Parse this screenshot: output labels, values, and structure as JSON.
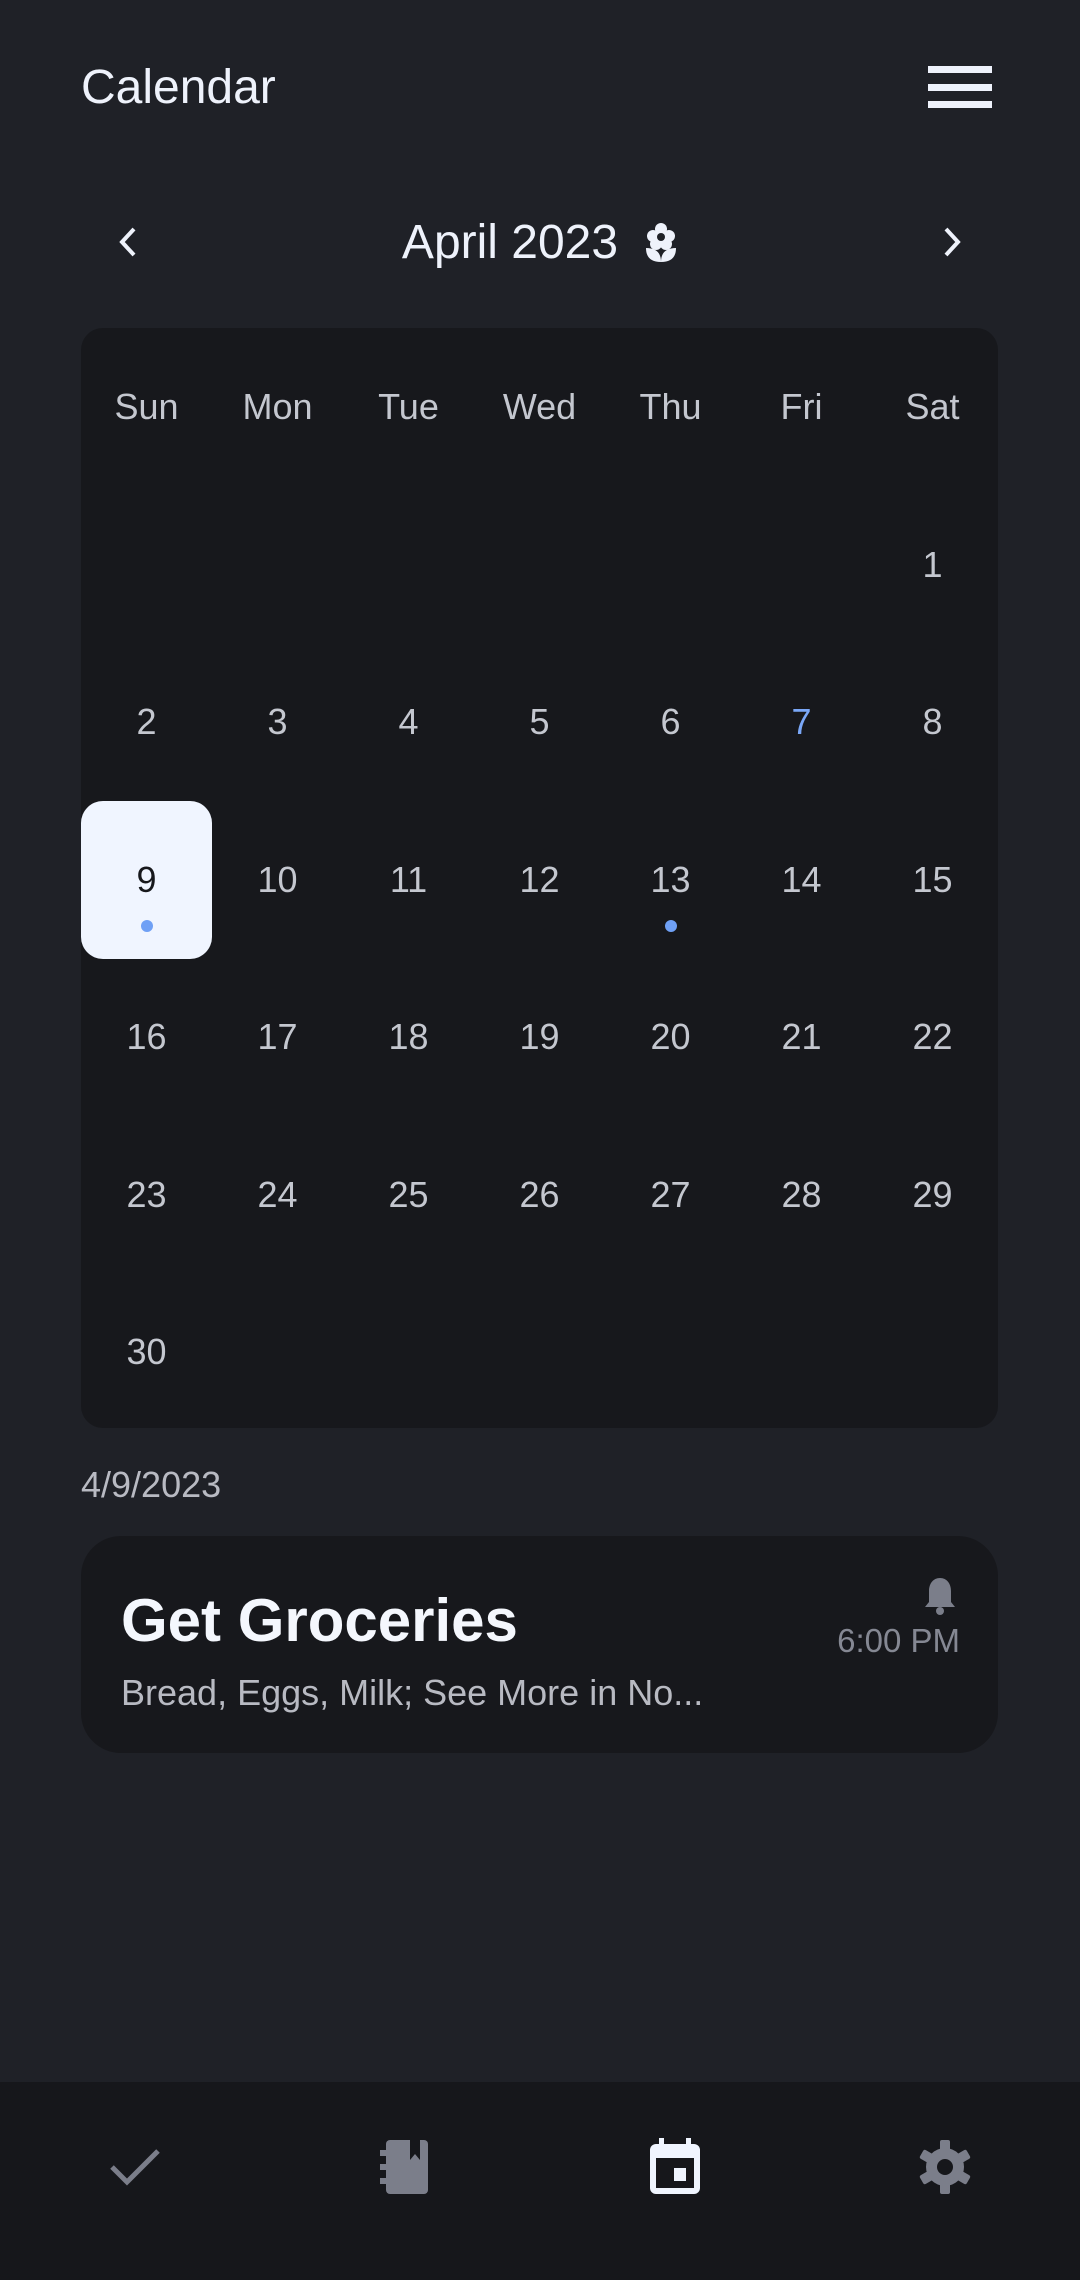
{
  "header": {
    "title": "Calendar",
    "menu_icon": "hamburger-menu-icon"
  },
  "month_nav": {
    "label": "April 2023",
    "season_icon": "flower-icon",
    "prev_icon": "chevron-left-icon",
    "next_icon": "chevron-right-icon"
  },
  "calendar": {
    "weekdays": [
      "Sun",
      "Mon",
      "Tue",
      "Wed",
      "Thu",
      "Fri",
      "Sat"
    ],
    "first_weekday_index": 6,
    "days_in_month": 30,
    "today": 7,
    "selected": 9,
    "days_with_events": [
      9,
      13
    ]
  },
  "selected_date_label": "4/9/2023",
  "events": [
    {
      "title": "Get Groceries",
      "subtitle": "Bread, Eggs, Milk; See More in No...",
      "time": "6:00 PM",
      "icon": "bell-icon"
    }
  ],
  "bottom_nav": [
    {
      "icon": "check-icon",
      "name": "tasks",
      "active": false
    },
    {
      "icon": "notebook-icon",
      "name": "notes",
      "active": false
    },
    {
      "icon": "calendar-icon",
      "name": "calendar",
      "active": true
    },
    {
      "icon": "gear-icon",
      "name": "settings",
      "active": false
    }
  ],
  "colors": {
    "background": "#1f2127",
    "card": "#17181c",
    "accent": "#7aa7f7",
    "selected_bg": "#f0f5ff",
    "muted_icon": "#7b7e8a"
  }
}
